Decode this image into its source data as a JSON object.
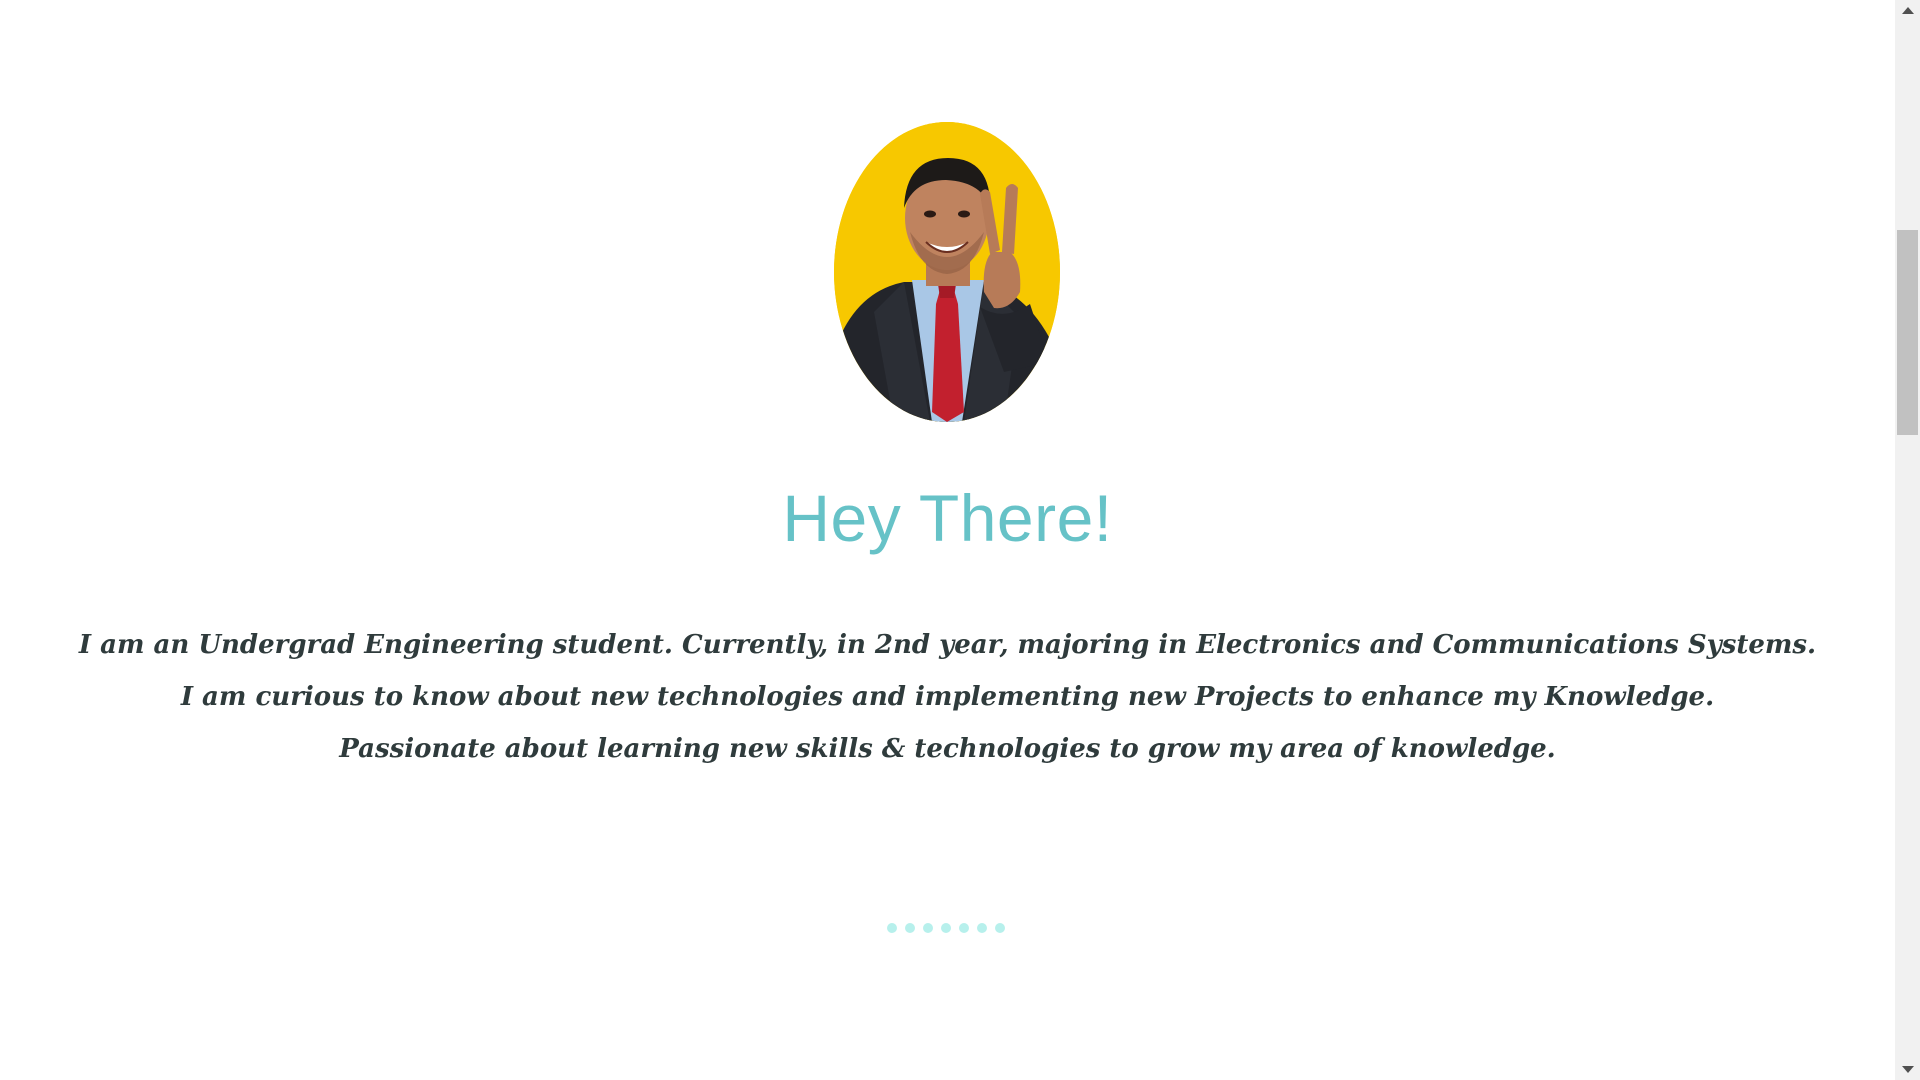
{
  "profile": {
    "avatar_alt": "Profile photo",
    "avatar_bg": "#f7c800"
  },
  "intro": {
    "heading": "Hey There!",
    "heading_color": "#66c2c7",
    "lines": [
      "I am an Undergrad Engineering student. Currently, in 2nd year, majoring in Electronics and Communications Systems.",
      "I am curious to know about new technologies and implementing new Projects to enhance my Knowledge.",
      "Passionate about learning new skills & technologies to grow my area of knowledge."
    ],
    "text_color": "#2f3b3c"
  },
  "loader": {
    "dot_count": 7,
    "dot_color": "#b7f0ec"
  },
  "scrollbar": {
    "up_icon": "arrow-up-icon",
    "down_icon": "arrow-down-icon"
  }
}
